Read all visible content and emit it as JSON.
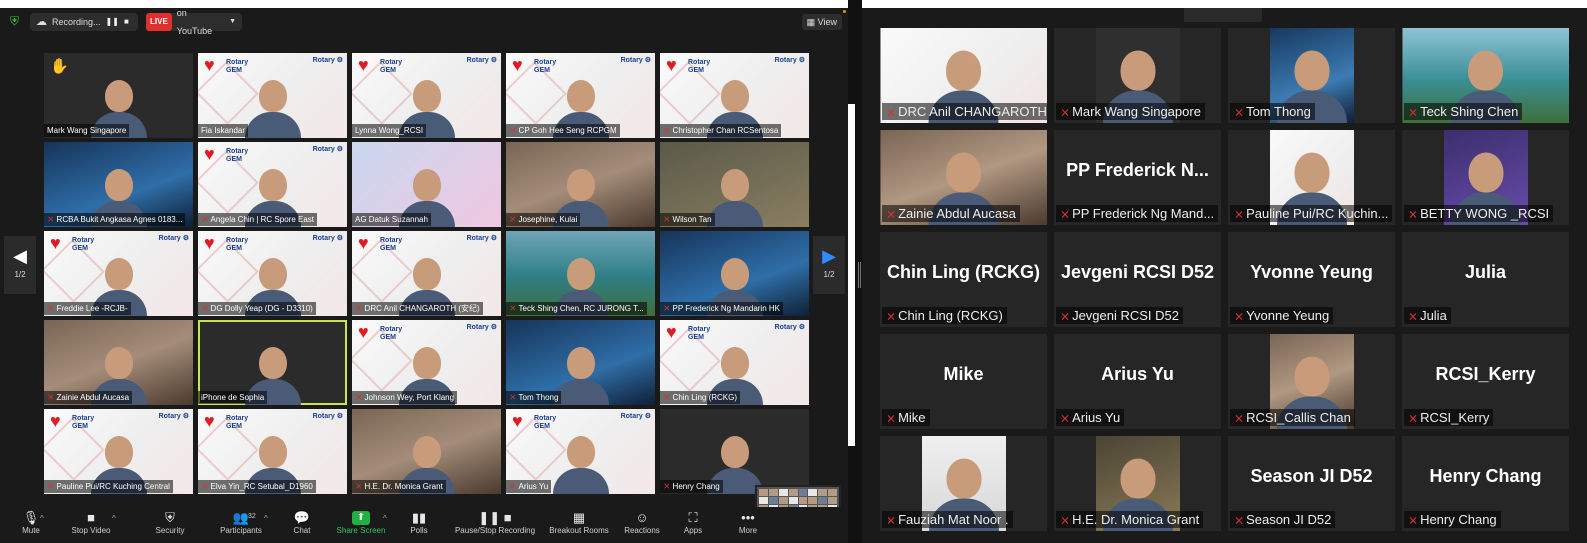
{
  "left_window": {
    "recording_label": "Recording...",
    "live_badge": "LIVE",
    "live_label": "on YouTube",
    "view_label": "View",
    "page_indicator": "1/2",
    "tiles": [
      {
        "name": "Mark Wang Singapore",
        "muted": false,
        "raised_hand": true,
        "bg": "dark"
      },
      {
        "name": "Fia Iskandar",
        "muted": false,
        "bg": "rotary"
      },
      {
        "name": "Lynna Wong_RCSI",
        "muted": false,
        "bg": "rotary"
      },
      {
        "name": "CP Goh Hee Seng RCPGM",
        "muted": true,
        "bg": "rotary"
      },
      {
        "name": "Christopher Chan RCSentosa",
        "muted": true,
        "bg": "rotary"
      },
      {
        "name": "RCBA Bukit Angkasa Agnes  0183...",
        "muted": true,
        "bg": "blue"
      },
      {
        "name": "Angela Chin | RC Spore East",
        "muted": true,
        "bg": "rotary"
      },
      {
        "name": "AG Datuk Suzannah",
        "muted": false,
        "bg": "pastel"
      },
      {
        "name": "Josephine, Kulai",
        "muted": true,
        "bg": "warm"
      },
      {
        "name": "Wilson Tan",
        "muted": true,
        "bg": "olive"
      },
      {
        "name": "Freddie Lee -RCJB-",
        "muted": true,
        "bg": "rotary"
      },
      {
        "name": "DG Dolly Yeap  (DG - D3310)",
        "muted": true,
        "bg": "rotary"
      },
      {
        "name": "DRC Anil CHANGAROTH (安纪)",
        "muted": true,
        "bg": "rotary"
      },
      {
        "name": "Teck Shing Chen, RC JURONG T...",
        "muted": true,
        "bg": "sea"
      },
      {
        "name": "PP Frederick Ng Mandarin HK",
        "muted": true,
        "bg": "blue"
      },
      {
        "name": "Zainie Abdul Aucasa",
        "muted": true,
        "bg": "warm"
      },
      {
        "name": "iPhone de Sophia",
        "muted": false,
        "bg": "dark",
        "highlight": true
      },
      {
        "name": "Johnson Wey, Port Klang",
        "muted": true,
        "bg": "rotary"
      },
      {
        "name": "Tom Thong",
        "muted": true,
        "bg": "blue"
      },
      {
        "name": "Chin Ling (RCKG)",
        "muted": true,
        "bg": "rotary"
      },
      {
        "name": "Pauline Pui/RC Kuching Central",
        "muted": true,
        "bg": "rotary"
      },
      {
        "name": "Elva Yin_RC Setubal_D1960",
        "muted": true,
        "bg": "rotary"
      },
      {
        "name": "H.E. Dr. Monica Grant",
        "muted": true,
        "bg": "warm"
      },
      {
        "name": "Arius Yu",
        "muted": true,
        "bg": "rotary"
      },
      {
        "name": "Henry Chang",
        "muted": true,
        "bg": "dark"
      }
    ],
    "toolbar": [
      {
        "label": "Mute",
        "icon": "microphone-icon",
        "glyph": "🎙",
        "caret": true
      },
      {
        "label": "Stop Video",
        "icon": "video-camera-icon",
        "glyph": "■",
        "caret": true
      },
      {
        "label": "Security",
        "icon": "shield-icon",
        "glyph": "⛨"
      },
      {
        "label": "Participants",
        "icon": "participants-icon",
        "glyph": "👥",
        "count": "32",
        "caret": true
      },
      {
        "label": "Chat",
        "icon": "chat-icon",
        "glyph": "💬"
      },
      {
        "label": "Share Screen",
        "icon": "share-screen-icon",
        "glyph": "⬆",
        "caret": true,
        "accent": true
      },
      {
        "label": "Polls",
        "icon": "polls-icon",
        "glyph": "▮▮"
      },
      {
        "label": "Pause/Stop Recording",
        "icon": "pause-stop-icon",
        "glyph": "❚❚ ■"
      },
      {
        "label": "Breakout Rooms",
        "icon": "breakout-rooms-icon",
        "glyph": "▦"
      },
      {
        "label": "Reactions",
        "icon": "reactions-icon",
        "glyph": "☺"
      },
      {
        "label": "Apps",
        "icon": "apps-icon",
        "glyph": "⛶"
      },
      {
        "label": "More",
        "icon": "more-icon",
        "glyph": "•••"
      }
    ]
  },
  "right_window": {
    "tiles": [
      {
        "name": "DRC Anil CHANGAROTH",
        "bg": "rotary",
        "video": "wide"
      },
      {
        "name": "Mark Wang Singapore",
        "bg": "dark",
        "video": "narrow"
      },
      {
        "name": "Tom Thong",
        "bg": "blue",
        "video": "narrow"
      },
      {
        "name": "Teck Shing Chen",
        "bg": "sea",
        "video": "wide"
      },
      {
        "name": "Zainie Abdul Aucasa",
        "bg": "warm",
        "video": "wide"
      },
      {
        "name": "PP Frederick Ng Mand...",
        "big": "PP Frederick N..."
      },
      {
        "name": "Pauline Pui/RC Kuchin...",
        "bg": "rotary",
        "video": "narrow"
      },
      {
        "name": "BETTY WONG _RCSI",
        "bg": "purple",
        "video": "narrow"
      },
      {
        "name": "Chin Ling (RCKG)",
        "big": "Chin Ling (RCKG)"
      },
      {
        "name": "Jevgeni RCSI D52",
        "big": "Jevgeni RCSI D52"
      },
      {
        "name": "Yvonne Yeung",
        "big": "Yvonne Yeung"
      },
      {
        "name": "Julia",
        "big": "Julia"
      },
      {
        "name": "Mike",
        "big": "Mike"
      },
      {
        "name": "Arius Yu",
        "big": "Arius Yu"
      },
      {
        "name": "RCSI_Callis Chan",
        "bg": "warm",
        "video": "narrow"
      },
      {
        "name": "RCSI_Kerry",
        "big": "RCSI_Kerry"
      },
      {
        "name": "Fauziah Mat Noor .",
        "bg": "pale",
        "video": "narrow"
      },
      {
        "name": "H.E. Dr. Monica Grant",
        "bg": "olive",
        "video": "narrow"
      },
      {
        "name": "Season JI D52",
        "big": "Season JI D52"
      },
      {
        "name": "Henry Chang",
        "big": "Henry Chang"
      }
    ]
  },
  "colors": {
    "accent_green": "#1fb141",
    "live_red": "#e0302d",
    "muted_red": "#e0302d",
    "pager_blue": "#2d8cff"
  }
}
